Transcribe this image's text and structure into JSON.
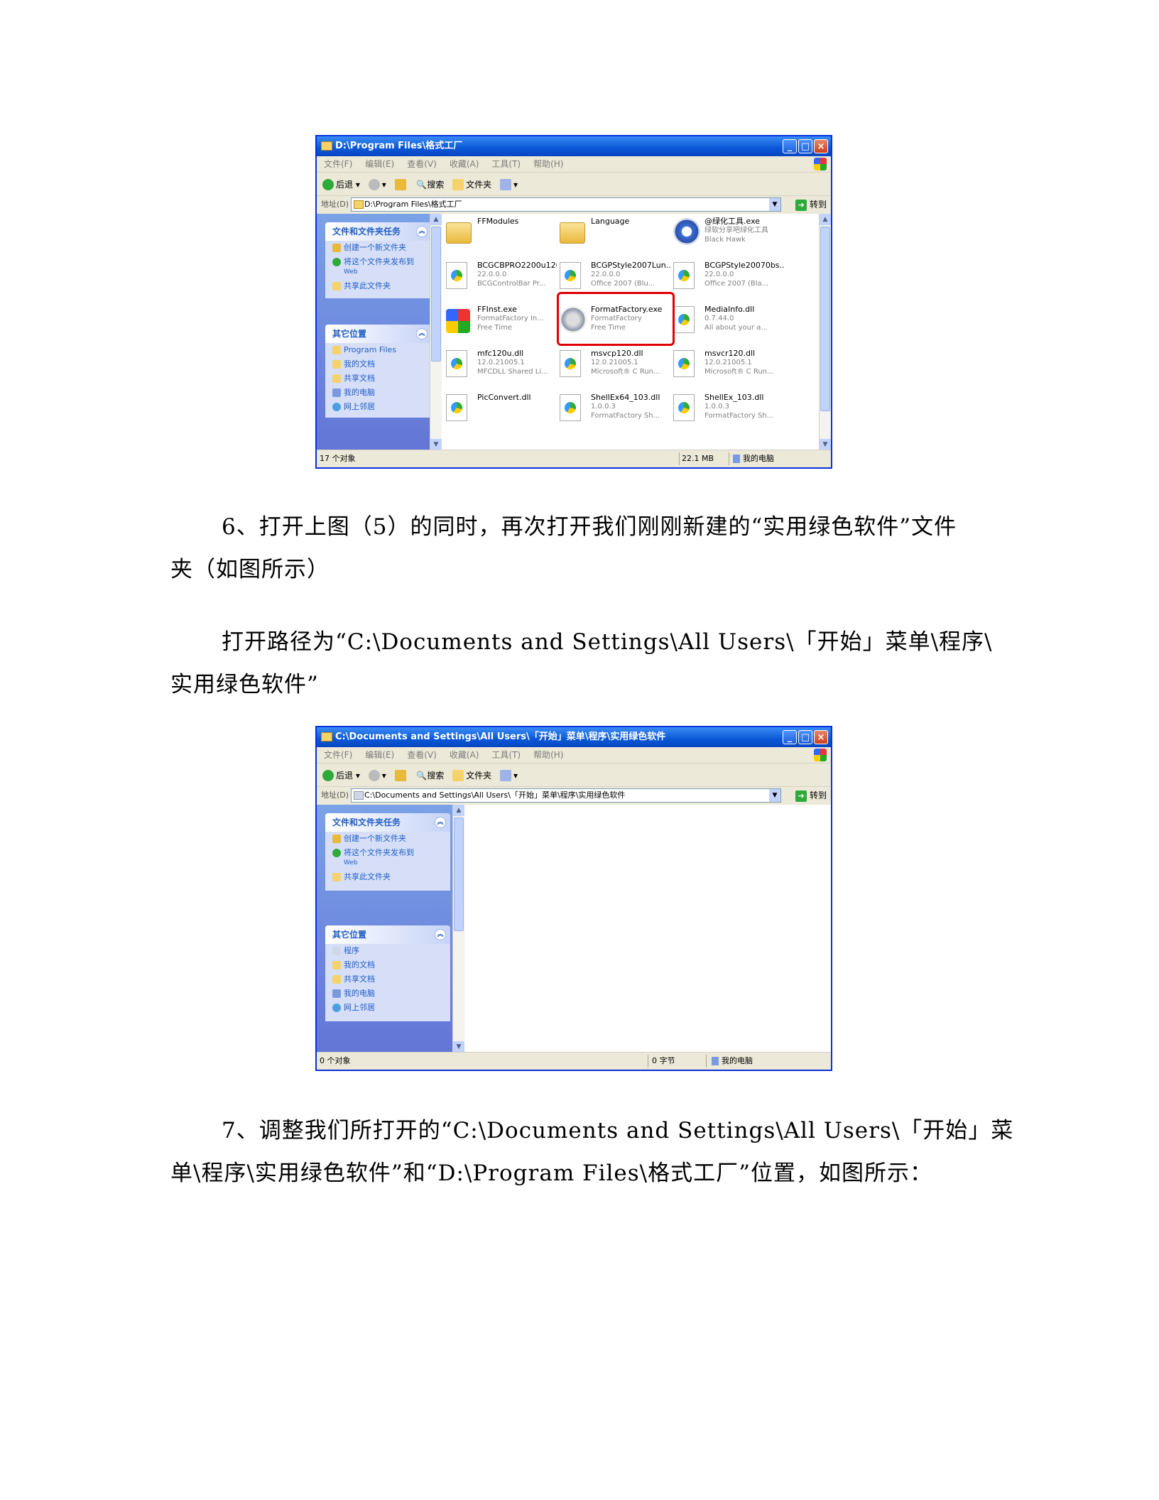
{
  "fig1": {
    "title": "D:\\Program Files\\格式工厂",
    "menu": [
      "文件(F)",
      "编辑(E)",
      "查看(V)",
      "收藏(A)",
      "工具(T)",
      "帮助(H)"
    ],
    "toolbar": {
      "back": "后退",
      "search": "搜索",
      "folders": "文件夹"
    },
    "address_label": "地址(D)",
    "address": "D:\\Program Files\\格式工厂",
    "go": "转到",
    "tasks_title": "文件和文件夹任务",
    "tasks": [
      "创建一个新文件夹",
      "将这个文件夹发布到",
      "共享此文件夹"
    ],
    "tasks_web": "Web",
    "places_title": "其它位置",
    "places": [
      "Program Files",
      "我的文档",
      "共享文档",
      "我的电脑",
      "网上邻居"
    ],
    "files": [
      {
        "l1": "FFModules",
        "l2": "",
        "l3": "",
        "icon": "folder"
      },
      {
        "l1": "Language",
        "l2": "",
        "l3": "",
        "icon": "folder"
      },
      {
        "l1": "@绿化工具.exe",
        "l2": "绿软分享吧绿化工具",
        "l3": "Black Hawk",
        "icon": "gear"
      },
      {
        "l1": "BCGCBPRO2200u120...",
        "l2": "22.0.0.0",
        "l3": "BCGControlBar Pr...",
        "icon": "dll"
      },
      {
        "l1": "BCGPStyle2007Lun...",
        "l2": "22.0.0.0",
        "l3": "Office 2007 (Blu...",
        "icon": "dll"
      },
      {
        "l1": "BCGPStyle20070bs...",
        "l2": "22.0.0.0",
        "l3": "Office 2007 (Bla...",
        "icon": "dll"
      },
      {
        "l1": "FFInst.exe",
        "l2": "FormatFactory In...",
        "l3": "Free Time",
        "icon": "win"
      },
      {
        "l1": "FormatFactory.exe",
        "l2": "FormatFactory",
        "l3": "Free Time",
        "icon": "ff"
      },
      {
        "l1": "MediaInfo.dll",
        "l2": "0.7.44.0",
        "l3": "All about your a...",
        "icon": "dll"
      },
      {
        "l1": "mfc120u.dll",
        "l2": "12.0.21005.1",
        "l3": "MFCDLL Shared Li...",
        "icon": "dll"
      },
      {
        "l1": "msvcp120.dll",
        "l2": "12.0.21005.1",
        "l3": "Microsoft® C Run...",
        "icon": "dll"
      },
      {
        "l1": "msvcr120.dll",
        "l2": "12.0.21005.1",
        "l3": "Microsoft® C Run...",
        "icon": "dll"
      },
      {
        "l1": "PicConvert.dll",
        "l2": "",
        "l3": "",
        "icon": "dll"
      },
      {
        "l1": "ShellEx64_103.dll",
        "l2": "1.0.0.3",
        "l3": "FormatFactory Sh...",
        "icon": "dll"
      },
      {
        "l1": "ShellEx_103.dll",
        "l2": "1.0.0.3",
        "l3": "FormatFactory Sh...",
        "icon": "dll"
      }
    ],
    "status_count": "17 个对象",
    "status_size": "22.1 MB",
    "status_location": "我的电脑"
  },
  "para6": {
    "line1": "6、打开上图（5）的同时，再次打开我们刚刚新建的“实用绿色软件”文件",
    "line2": "夹（如图所示）",
    "line3": "打开路径为“C:\\Documents and Settings\\All Users\\「开始」菜单\\程序\\",
    "line4": "实用绿色软件”"
  },
  "fig2": {
    "title": "C:\\Documents and Settings\\All Users\\「开始」菜单\\程序\\实用绿色软件",
    "menu": [
      "文件(F)",
      "编辑(E)",
      "查看(V)",
      "收藏(A)",
      "工具(T)",
      "帮助(H)"
    ],
    "toolbar": {
      "back": "后退",
      "search": "搜索",
      "folders": "文件夹"
    },
    "address_label": "地址(D)",
    "address": "C:\\Documents and Settings\\All Users\\「开始」菜单\\程序\\实用绿色软件",
    "go": "转到",
    "tasks_title": "文件和文件夹任务",
    "tasks": [
      "创建一个新文件夹",
      "将这个文件夹发布到",
      "共享此文件夹"
    ],
    "tasks_web": "Web",
    "places_title": "其它位置",
    "places": [
      "程序",
      "我的文档",
      "共享文档",
      "我的电脑",
      "网上邻居"
    ],
    "status_count": "0 个对象",
    "status_size": "0 字节",
    "status_location": "我的电脑"
  },
  "para7": {
    "line1": "7、调整我们所打开的“C:\\Documents and Settings\\All Users\\「开始」菜",
    "line2": "单\\程序\\实用绿色软件”和“D:\\Program Files\\格式工厂”位置，如图所示："
  },
  "colors": {
    "xp_blue": "#0a57d6",
    "highlight_red": "#e00000",
    "task_text": "#215dc6"
  }
}
